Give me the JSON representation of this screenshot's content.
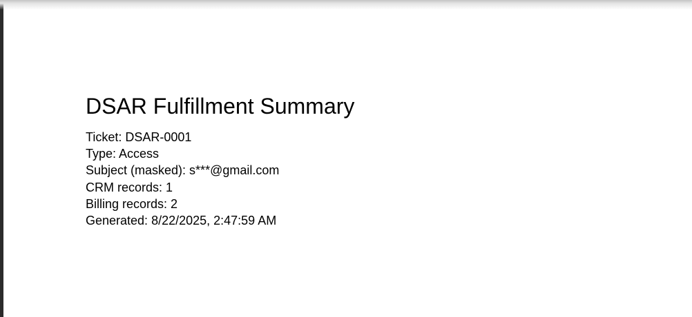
{
  "document": {
    "title": "DSAR Fulfillment Summary",
    "lines": [
      "Ticket: DSAR-0001",
      "Type: Access",
      "Subject (masked): s***@gmail.com",
      "CRM records: 1",
      "Billing records: 2",
      "Generated: 8/22/2025, 2:47:59 AM"
    ]
  }
}
